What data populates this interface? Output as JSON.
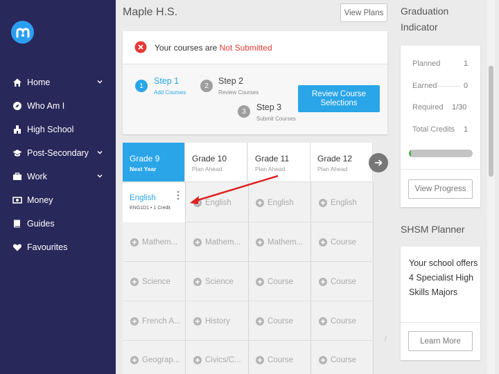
{
  "sidebar": {
    "items": [
      {
        "label": "Home",
        "icon": "home-icon",
        "has_chevron": true
      },
      {
        "label": "Who Am I",
        "icon": "compass-icon",
        "has_chevron": false
      },
      {
        "label": "High School",
        "icon": "school-icon",
        "has_chevron": false
      },
      {
        "label": "Post-Secondary",
        "icon": "graduation-cap-icon",
        "has_chevron": true
      },
      {
        "label": "Work",
        "icon": "briefcase-icon",
        "has_chevron": true
      },
      {
        "label": "Money",
        "icon": "money-icon",
        "has_chevron": false
      },
      {
        "label": "Guides",
        "icon": "book-icon",
        "has_chevron": false
      },
      {
        "label": "Favourites",
        "icon": "heart-icon",
        "has_chevron": false
      }
    ]
  },
  "header": {
    "school": "Maple H.S.",
    "view_plans": "View Plans"
  },
  "status": {
    "prefix": "Your courses are ",
    "state": "Not Submitted"
  },
  "steps": [
    {
      "num": "1",
      "title": "Step 1",
      "sub": "Add Courses",
      "active": true
    },
    {
      "num": "2",
      "title": "Step 2",
      "sub": "Review Courses",
      "active": false
    },
    {
      "num": "3",
      "title": "Step 3",
      "sub": "Submit Courses",
      "active": false
    }
  ],
  "review_button": "Review Course Selections",
  "grades": [
    {
      "name": "Grade 9",
      "sub": "Next Year",
      "active": true
    },
    {
      "name": "Grade 10",
      "sub": "Plan Ahead",
      "active": false
    },
    {
      "name": "Grade 11",
      "sub": "Plan Ahead",
      "active": false
    },
    {
      "name": "Grade 12",
      "sub": "Plan Ahead",
      "active": false
    }
  ],
  "selected_course": {
    "name": "English",
    "code": "ENG1D1 • 1 Credit"
  },
  "course_rows": [
    [
      "",
      "English",
      "English",
      "English"
    ],
    [
      "Mathem...",
      "Mathem...",
      "Mathem...",
      "Course"
    ],
    [
      "Science",
      "Science",
      "Course",
      "Course"
    ],
    [
      "French A...",
      "History",
      "Course",
      "Course"
    ],
    [
      "Geograp...",
      "Civics/C...",
      "Course",
      "Course"
    ]
  ],
  "graduation": {
    "title": "Graduation Indicator",
    "planned_label": "Planned",
    "planned": "1",
    "earned_label": "Earned",
    "earned": "0",
    "required_label": "Required",
    "required": "1/30",
    "total_label": "Total Credits",
    "total": "1",
    "progress_fraction": 0.033,
    "view_progress": "View Progress"
  },
  "shsm": {
    "title": "SHSM Planner",
    "text": "Your school offers 4 Specialist High Skills Majors",
    "learn_more": "Learn More"
  },
  "colors": {
    "sidebar_bg": "#29285a",
    "accent_blue": "#2aa5e8",
    "alert_red": "#e53935",
    "progress_green": "#4caf50",
    "annotation_arrow": "#e02020"
  }
}
